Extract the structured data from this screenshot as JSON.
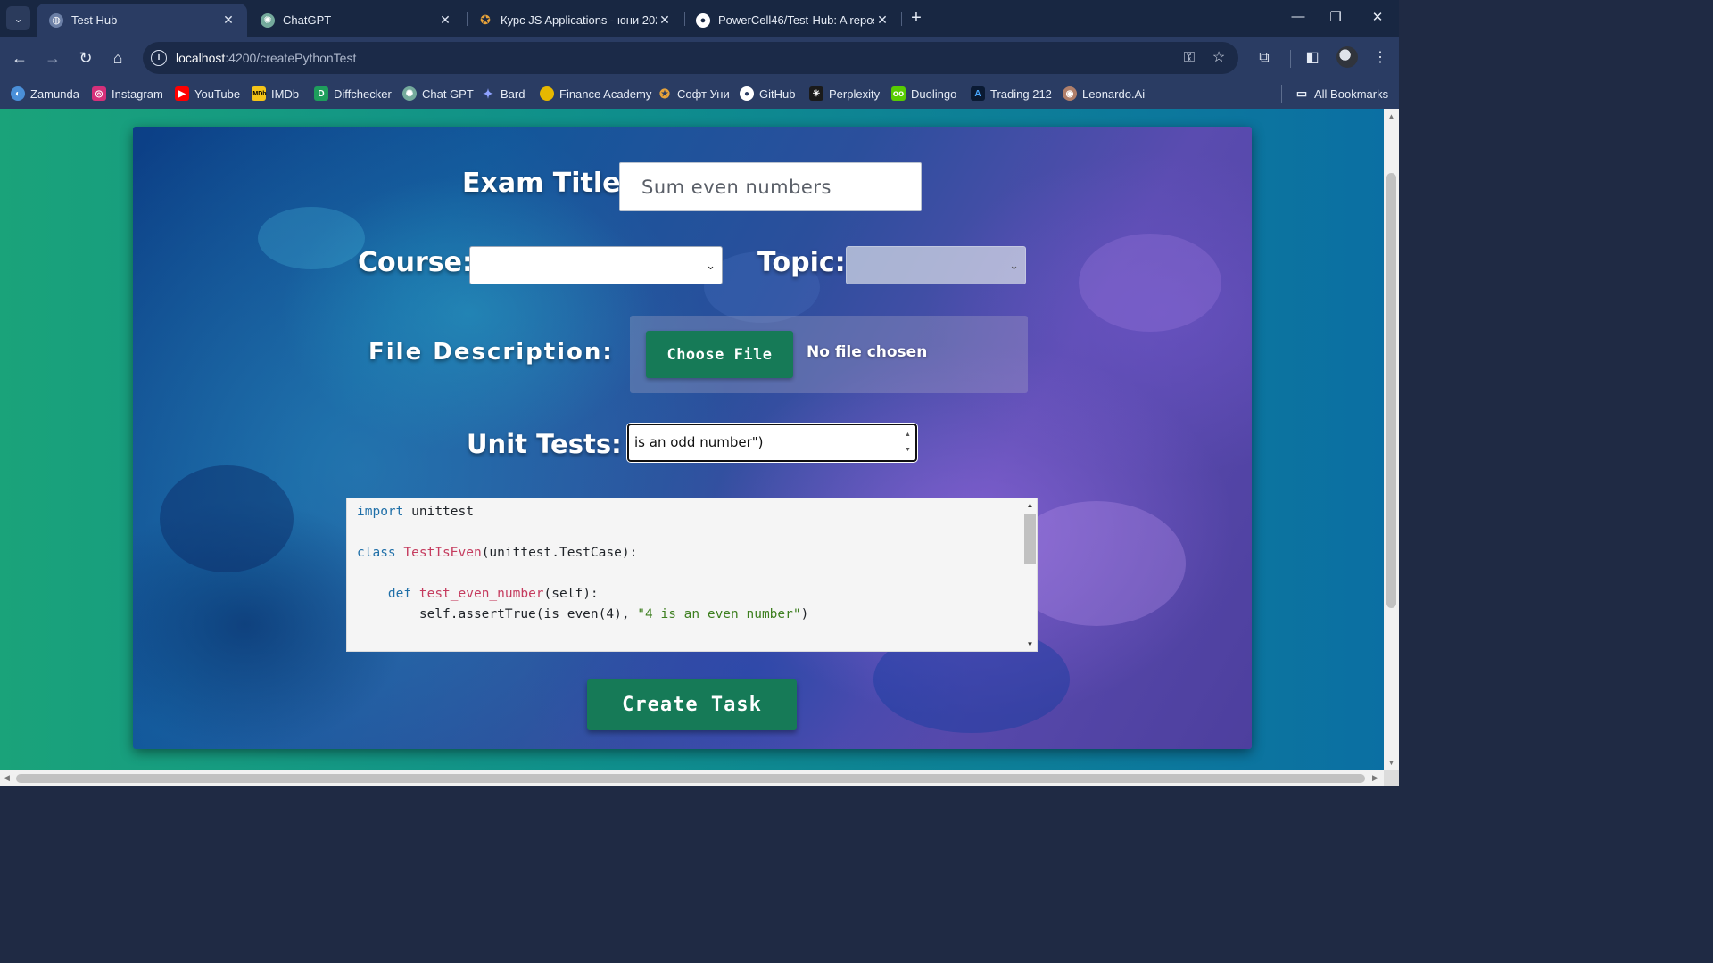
{
  "browser": {
    "tabs": [
      {
        "title": "Test Hub",
        "active": true
      },
      {
        "title": "ChatGPT",
        "active": false
      },
      {
        "title": "Курс JS Applications - юни 202",
        "active": false
      },
      {
        "title": "PowerCell46/Test-Hub: A reposi",
        "active": false
      }
    ],
    "url_host": "localhost",
    "url_rest": ":4200/createPythonTest",
    "bookmarks": [
      {
        "label": "Zamunda",
        "icon": "zamunda-icon",
        "color": "#4a8fd8"
      },
      {
        "label": "Instagram",
        "icon": "instagram-icon",
        "color": "#d6307a"
      },
      {
        "label": "YouTube",
        "icon": "youtube-icon",
        "color": "#ff0000"
      },
      {
        "label": "IMDb",
        "icon": "imdb-icon",
        "color": "#f5c518"
      },
      {
        "label": "Diffchecker",
        "icon": "diffchecker-icon",
        "color": "#1e9e5c"
      },
      {
        "label": "Chat GPT",
        "icon": "chatgpt-icon",
        "color": "#74aa9c"
      },
      {
        "label": "Bard",
        "icon": "bard-icon",
        "color": "#6b7cf2"
      },
      {
        "label": "Finance Academy",
        "icon": "finance-academy-icon",
        "color": "#e6b800"
      },
      {
        "label": "Софт Уни",
        "icon": "softuni-icon",
        "color": "#e8a33a"
      },
      {
        "label": "GitHub",
        "icon": "github-icon",
        "color": "#ffffff"
      },
      {
        "label": "Perplexity",
        "icon": "perplexity-icon",
        "color": "#1a1a1a"
      },
      {
        "label": "Duolingo",
        "icon": "duolingo-icon",
        "color": "#58cc02"
      },
      {
        "label": "Trading 212",
        "icon": "trading212-icon",
        "color": "#0c74d4"
      },
      {
        "label": "Leonardo.Ai",
        "icon": "leonardo-icon",
        "color": "#b07f6a"
      }
    ],
    "all_bookmarks": "All Bookmarks"
  },
  "form": {
    "exam_title_label": "Exam Title:",
    "exam_title_value": "Sum even numbers",
    "course_label": "Course:",
    "course_value": "",
    "topic_label": "Topic:",
    "topic_value": "",
    "file_label": "File Description:",
    "file_button": "Choose File",
    "file_status": "No file chosen",
    "unit_tests_label": "Unit Tests:",
    "unit_tests_value": "is an odd number\")",
    "create_button": "Create Task"
  },
  "code": {
    "lines": [
      "import unittest",
      "",
      "class TestIsEven(unittest.TestCase):",
      "",
      "    def test_even_number(self):",
      "        self.assertTrue(is_even(4), \"4 is an even number\")"
    ]
  },
  "colors": {
    "accent_green": "#167a57",
    "page_bg_start": "#1aa37a",
    "page_bg_end": "#0b6fa3"
  }
}
